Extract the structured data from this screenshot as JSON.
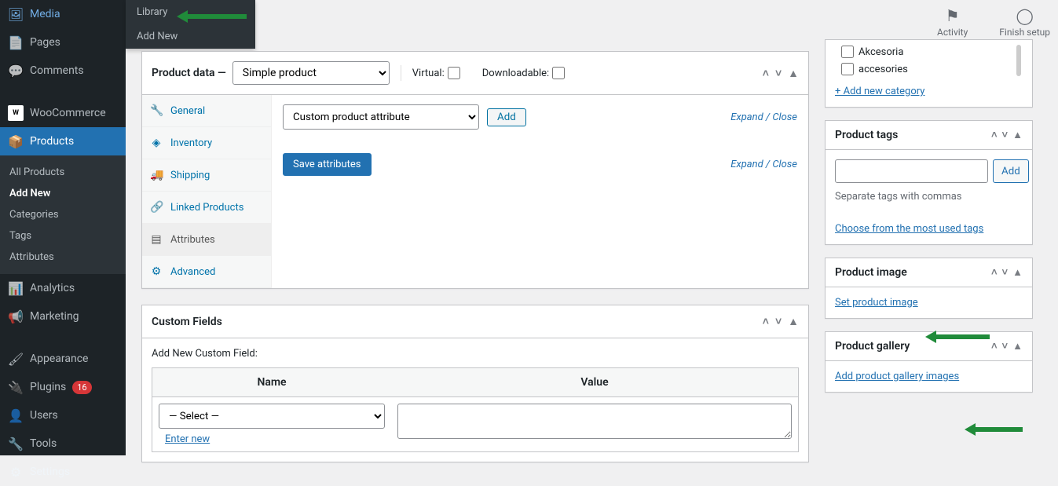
{
  "topbar": {
    "activity": {
      "label": "Activity"
    },
    "finish": {
      "label": "Finish setup"
    }
  },
  "sidebar": {
    "items": {
      "media": "Media",
      "pages": "Pages",
      "comments": "Comments",
      "woocommerce": "WooCommerce",
      "products": "Products",
      "analytics": "Analytics",
      "marketing": "Marketing",
      "appearance": "Appearance",
      "plugins": "Plugins",
      "plugins_badge": "16",
      "users": "Users",
      "tools": "Tools",
      "settings": "Settings"
    },
    "products_sub": {
      "all": "All Products",
      "add": "Add New",
      "categories": "Categories",
      "tags": "Tags",
      "attributes": "Attributes"
    },
    "media_flyout": {
      "library": "Library",
      "add": "Add New"
    }
  },
  "product_data": {
    "header_prefix": "Product data —",
    "type_select": "Simple product",
    "virtual_label": "Virtual:",
    "downloadable_label": "Downloadable:",
    "tabs": {
      "general": "General",
      "inventory": "Inventory",
      "shipping": "Shipping",
      "linked": "Linked Products",
      "attributes": "Attributes",
      "advanced": "Advanced"
    },
    "attr_select": "Custom product attribute",
    "add_btn": "Add",
    "expand": "Expand / Close",
    "save_btn": "Save attributes"
  },
  "custom_fields": {
    "header": "Custom Fields",
    "label": "Add New Custom Field:",
    "col_name": "Name",
    "col_value": "Value",
    "select_placeholder": "— Select —",
    "enter_new": "Enter new"
  },
  "categories_box": {
    "items": [
      "Akcesoria",
      "accesories"
    ],
    "add": "+ Add new category"
  },
  "tags_box": {
    "header": "Product tags",
    "add": "Add",
    "help": "Separate tags with commas",
    "choose": "Choose from the most used tags"
  },
  "image_box": {
    "header": "Product image",
    "link": "Set product image"
  },
  "gallery_box": {
    "header": "Product gallery",
    "link": "Add product gallery images"
  }
}
